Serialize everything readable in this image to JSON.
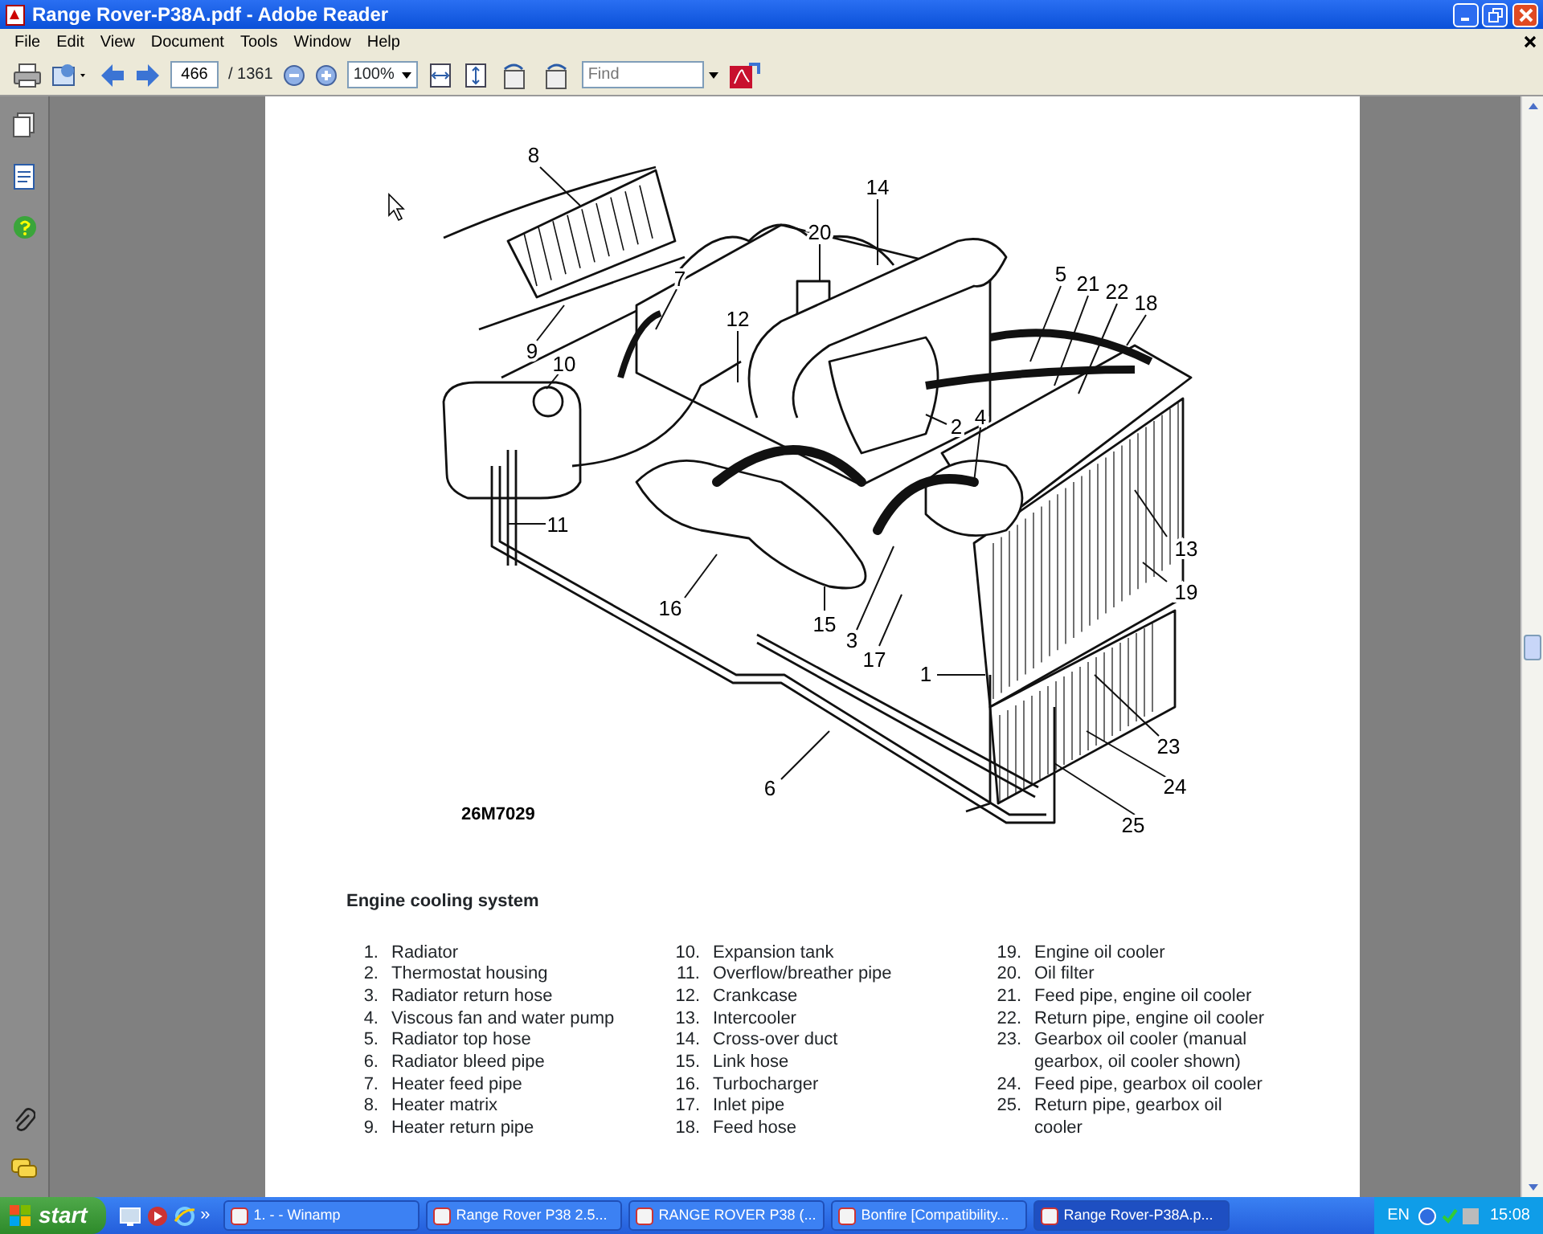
{
  "window": {
    "title": "Range Rover-P38A.pdf - Adobe Reader"
  },
  "menu": [
    "File",
    "Edit",
    "View",
    "Document",
    "Tools",
    "Window",
    "Help"
  ],
  "toolbar": {
    "page_number": "466",
    "page_count": "/ 1361",
    "zoom": "100%",
    "find": {
      "placeholder": "Find"
    }
  },
  "document": {
    "callouts": [
      "8",
      "14",
      "20",
      "7",
      "12",
      "5",
      "21",
      "22",
      "18",
      "9",
      "10",
      "2",
      "4",
      "11",
      "13",
      "19",
      "16",
      "15",
      "3",
      "17",
      "1",
      "23",
      "24",
      "6",
      "25"
    ],
    "figure_code": "26M7029",
    "caption": "Engine cooling system",
    "legend_columns": [
      [
        {
          "number": "1.",
          "text": "Radiator"
        },
        {
          "number": "2.",
          "text": "Thermostat housing"
        },
        {
          "number": "3.",
          "text": "Radiator return hose"
        },
        {
          "number": "4.",
          "text": "Viscous fan and water pump"
        },
        {
          "number": "5.",
          "text": "Radiator top hose"
        },
        {
          "number": "6.",
          "text": "Radiator bleed pipe"
        },
        {
          "number": "7.",
          "text": "Heater feed pipe"
        },
        {
          "number": "8.",
          "text": "Heater matrix"
        },
        {
          "number": "9.",
          "text": "Heater return pipe"
        }
      ],
      [
        {
          "number": "10.",
          "text": "Expansion tank"
        },
        {
          "number": "11.",
          "text": "Overflow/breather pipe"
        },
        {
          "number": "12.",
          "text": "Crankcase"
        },
        {
          "number": "13.",
          "text": "Intercooler"
        },
        {
          "number": "14.",
          "text": "Cross-over duct"
        },
        {
          "number": "15.",
          "text": "Link hose"
        },
        {
          "number": "16.",
          "text": "Turbocharger"
        },
        {
          "number": "17.",
          "text": "Inlet pipe"
        },
        {
          "number": "18.",
          "text": "Feed hose"
        }
      ],
      [
        {
          "number": "19.",
          "text": "Engine oil cooler"
        },
        {
          "number": "20.",
          "text": "Oil filter"
        },
        {
          "number": "21.",
          "text": "Feed pipe, engine oil cooler"
        },
        {
          "number": "22.",
          "text": "Return pipe, engine oil cooler"
        },
        {
          "number": "23.",
          "text": "Gearbox oil cooler (manual gearbox, oil cooler shown)"
        },
        {
          "number": "24.",
          "text": "Feed pipe, gearbox oil cooler"
        },
        {
          "number": "25.",
          "text": "Return pipe, gearbox oil cooler"
        }
      ]
    ]
  },
  "taskbar": {
    "start": "start",
    "more": "»",
    "tasks": [
      {
        "label": "1. - - Winamp",
        "selected": false
      },
      {
        "label": "Range Rover P38 2.5...",
        "selected": false
      },
      {
        "label": "RANGE ROVER P38 (...",
        "selected": false
      },
      {
        "label": "Bonfire [Compatibility...",
        "selected": false
      },
      {
        "label": "Range Rover-P38A.p...",
        "selected": true
      }
    ],
    "language": "EN",
    "clock": "15:08"
  }
}
